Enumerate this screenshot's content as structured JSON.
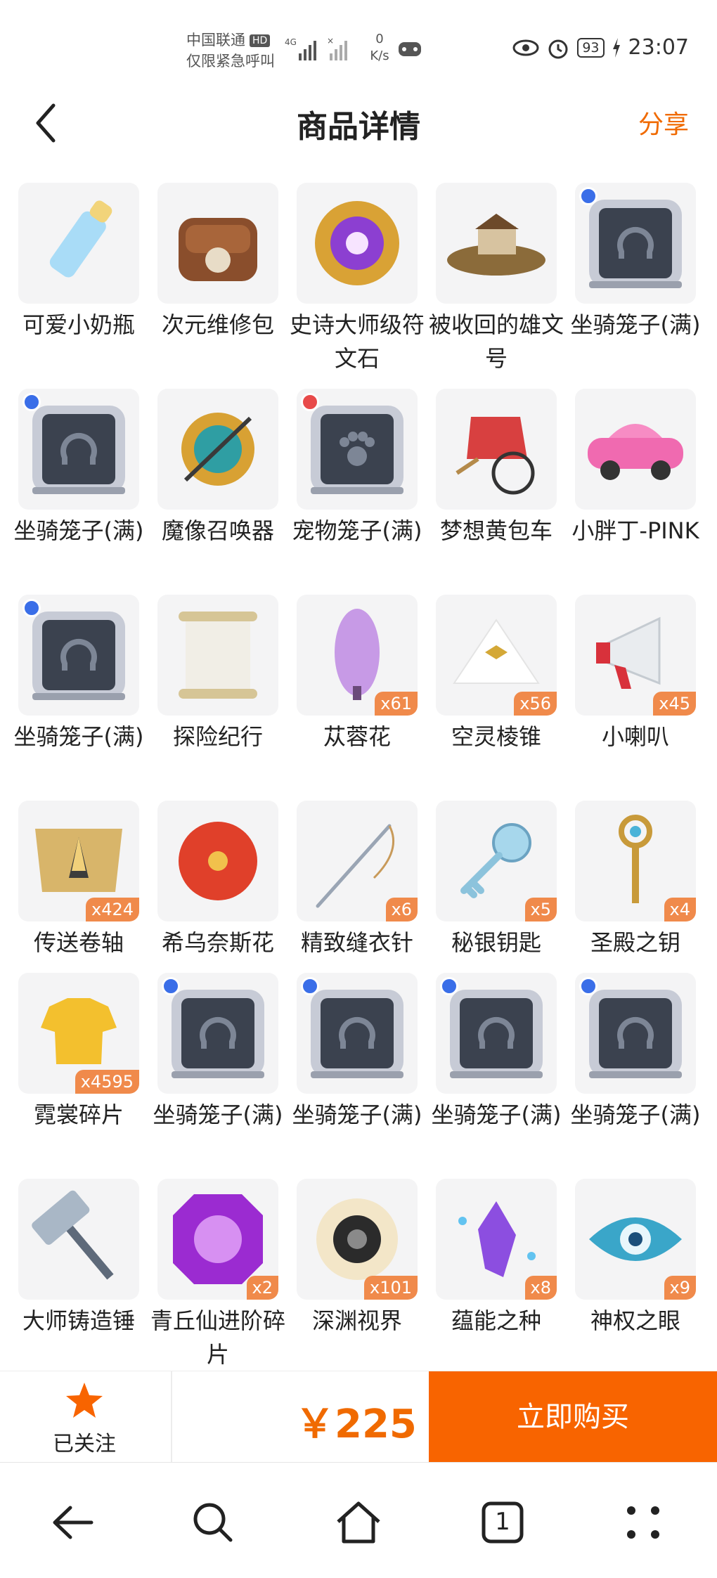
{
  "status_bar": {
    "carrier_line1": "中国联通",
    "hd": "HD",
    "carrier_line2": "仅限紧急呼叫",
    "net": "4G",
    "speed_value": "0",
    "speed_unit": "K/s",
    "battery": "93",
    "time": "23:07"
  },
  "header": {
    "title": "商品详情",
    "share": "分享"
  },
  "items": [
    {
      "name": "可爱小奶瓶",
      "qty": "",
      "icon": "baby-bottle-icon"
    },
    {
      "name": "次元维修包",
      "qty": "",
      "icon": "repair-bag-icon"
    },
    {
      "name": "史诗大师级符文石",
      "qty": "",
      "icon": "rune-stone-icon"
    },
    {
      "name": "被收回的雄文号",
      "qty": "",
      "icon": "ship-icon"
    },
    {
      "name": "坐骑笼子(满)",
      "qty": "",
      "icon": "mount-cage-icon"
    },
    {
      "name": "坐骑笼子(满)",
      "qty": "",
      "icon": "mount-cage-icon"
    },
    {
      "name": "魔像召唤器",
      "qty": "",
      "icon": "golem-summoner-icon"
    },
    {
      "name": "宠物笼子(满)",
      "qty": "",
      "icon": "pet-cage-icon"
    },
    {
      "name": "梦想黄包车",
      "qty": "",
      "icon": "rickshaw-icon"
    },
    {
      "name": "小胖丁-PINK",
      "qty": "",
      "icon": "pink-car-icon"
    },
    {
      "name": "坐骑笼子(满)",
      "qty": "",
      "icon": "mount-cage-icon"
    },
    {
      "name": "探险纪行",
      "qty": "",
      "icon": "scroll-icon"
    },
    {
      "name": "苁蓉花",
      "qty": "x61",
      "icon": "purple-flower-icon"
    },
    {
      "name": "空灵棱锥",
      "qty": "x56",
      "icon": "pyramid-icon"
    },
    {
      "name": "小喇叭",
      "qty": "x45",
      "icon": "megaphone-icon"
    },
    {
      "name": "传送卷轴",
      "qty": "x424",
      "icon": "teleport-scroll-icon"
    },
    {
      "name": "希乌奈斯花",
      "qty": "",
      "icon": "red-flower-icon"
    },
    {
      "name": "精致缝衣针",
      "qty": "x6",
      "icon": "needle-icon"
    },
    {
      "name": "秘银钥匙",
      "qty": "x5",
      "icon": "mithril-key-icon"
    },
    {
      "name": "圣殿之钥",
      "qty": "x4",
      "icon": "temple-key-icon"
    },
    {
      "name": "霓裳碎片",
      "qty": "x4595",
      "icon": "shirt-fragment-icon"
    },
    {
      "name": "坐骑笼子(满)",
      "qty": "",
      "icon": "mount-cage-icon"
    },
    {
      "name": "坐骑笼子(满)",
      "qty": "",
      "icon": "mount-cage-icon"
    },
    {
      "name": "坐骑笼子(满)",
      "qty": "",
      "icon": "mount-cage-icon"
    },
    {
      "name": "坐骑笼子(满)",
      "qty": "",
      "icon": "mount-cage-icon"
    },
    {
      "name": "大师铸造锤",
      "qty": "",
      "icon": "hammer-icon"
    },
    {
      "name": "青丘仙进阶碎片",
      "qty": "x2",
      "icon": "purple-gem-icon"
    },
    {
      "name": "深渊视界",
      "qty": "x101",
      "icon": "abyss-eye-icon"
    },
    {
      "name": "蕴能之种",
      "qty": "x8",
      "icon": "crystal-seed-icon"
    },
    {
      "name": "神权之眼",
      "qty": "x9",
      "icon": "divine-eye-icon"
    }
  ],
  "action_bar": {
    "follow_label": "已关注",
    "price": "￥225",
    "buy_label": "立即购买"
  },
  "system_nav": {
    "tab_count": "1"
  },
  "colors": {
    "accent": "#f06a00",
    "buy_button": "#f86400",
    "qty_badge": "#f08a4b"
  }
}
